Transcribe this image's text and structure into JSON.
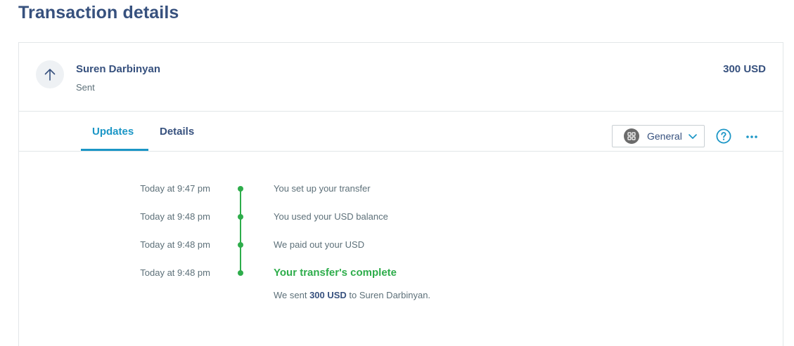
{
  "page": {
    "title": "Transaction details"
  },
  "transaction": {
    "recipient": "Suren Darbinyan",
    "status": "Sent",
    "amount": "300 USD",
    "icon": "arrow-up-icon"
  },
  "tabs": [
    {
      "label": "Updates",
      "active": true
    },
    {
      "label": "Details",
      "active": false
    }
  ],
  "toolbar": {
    "category_label": "General",
    "category_icon": "grid-icon",
    "help_icon": "help-circle-icon",
    "more_icon": "more-horizontal-icon"
  },
  "timeline": [
    {
      "time": "Today at 9:47 pm",
      "text": "You set up your transfer"
    },
    {
      "time": "Today at 9:48 pm",
      "text": "You used your USD balance"
    },
    {
      "time": "Today at 9:48 pm",
      "text": "We paid out your USD"
    },
    {
      "time": "Today at 9:48 pm",
      "text": "Your transfer's complete",
      "detail": {
        "prefix": "We sent ",
        "amount": "300 USD",
        "suffix": " to Suren Darbinyan."
      }
    }
  ],
  "colors": {
    "accent": "#1b96c6",
    "success": "#2ead4b",
    "text": "#37517e",
    "muted": "#5d7079"
  }
}
